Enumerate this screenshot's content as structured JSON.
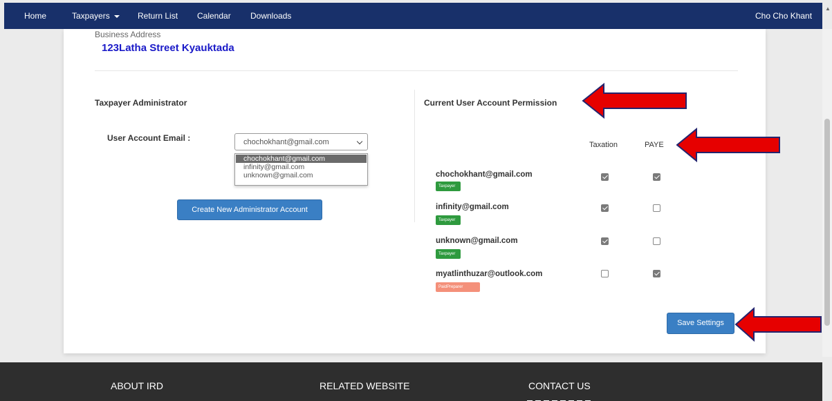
{
  "navbar": {
    "items": [
      {
        "label": "Home"
      },
      {
        "label": "Taxpayers"
      },
      {
        "label": "Return List"
      },
      {
        "label": "Calendar"
      },
      {
        "label": "Downloads"
      }
    ],
    "user": "Cho Cho Khant",
    "background": "#18306a"
  },
  "business": {
    "label": "Business Address",
    "address": "123Latha Street Kyauktada"
  },
  "admin": {
    "title": "Taxpayer Administrator",
    "email_label": "User Account Email :",
    "selected_email": "chochokhant@gmail.com",
    "options": [
      "chochokhant@gmail.com",
      "infinity@gmail.com",
      "unknown@gmail.com"
    ],
    "create_button": "Create New Administrator Account"
  },
  "permissions": {
    "title": "Current User Account Permission",
    "columns": [
      "Taxation",
      "PAYE"
    ],
    "rows": [
      {
        "email": "chochokhant@gmail.com",
        "role": "Taxpayer",
        "taxation": true,
        "paye": true
      },
      {
        "email": "infinity@gmail.com",
        "role": "Taxpayer",
        "taxation": true,
        "paye": false
      },
      {
        "email": "unknown@gmail.com",
        "role": "Taxpayer",
        "taxation": true,
        "paye": false
      },
      {
        "email": "myatlinthuzar@outlook.com",
        "role": "PaidPreparer",
        "taxation": false,
        "paye": true
      }
    ],
    "save_button": "Save Settings"
  },
  "footer": {
    "about": "ABOUT IRD",
    "related": "RELATED WEBSITE",
    "contact": "CONTACT US"
  },
  "colors": {
    "accent": "#3a7fc4",
    "address": "#1a1ac8",
    "badge_taxpayer": "#2e9a3e",
    "badge_preparer": "#f4907a",
    "annotation_arrow": "#e60000"
  }
}
